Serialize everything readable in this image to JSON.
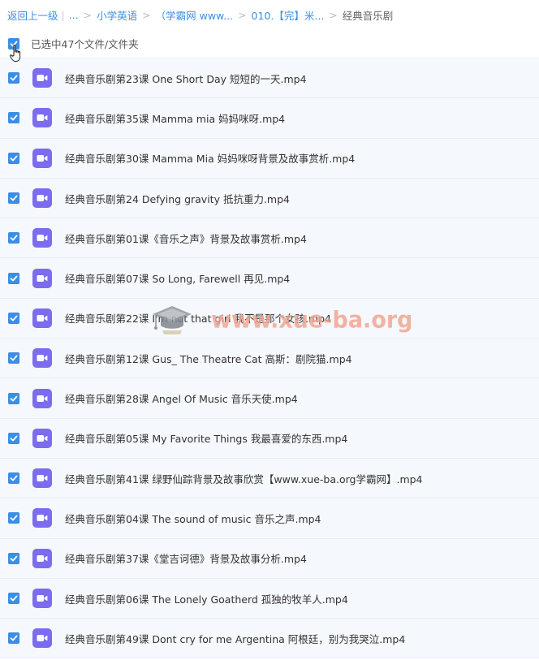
{
  "breadcrumb": {
    "back_label": "返回上一级",
    "ellipsis": "...",
    "items": [
      "小学英语",
      "（学霸网 www...",
      "010.【完】米..."
    ],
    "current": "经典音乐剧"
  },
  "selection": {
    "label": "已选中47个文件/文件夹",
    "checked": true
  },
  "files": [
    {
      "name": "经典音乐剧第23课 One Short Day 短短的一天.mp4",
      "checked": true
    },
    {
      "name": "经典音乐剧第35课 Mamma mia 妈妈咪呀.mp4",
      "checked": true
    },
    {
      "name": "经典音乐剧第30课 Mamma Mia 妈妈咪呀背景及故事赏析.mp4",
      "checked": true
    },
    {
      "name": "经典音乐剧第24 Defying  gravity 抵抗重力.mp4",
      "checked": true
    },
    {
      "name": "经典音乐剧第01课《音乐之声》背景及故事赏析.mp4",
      "checked": true
    },
    {
      "name": "经典音乐剧第07课 So Long, Farewell 再见.mp4",
      "checked": true
    },
    {
      "name": "经典音乐剧第22课 I'm not that girl 我不是那个女孩.mp4",
      "checked": true
    },
    {
      "name": "经典音乐剧第12课 Gus_ The Theatre Cat 高斯：剧院猫.mp4",
      "checked": true
    },
    {
      "name": "经典音乐剧第28课 Angel Of Music 音乐天使.mp4",
      "checked": true
    },
    {
      "name": "经典音乐剧第05课 My Favorite Things 我最喜爱的东西.mp4",
      "checked": true
    },
    {
      "name": "经典音乐剧第41课 绿野仙踪背景及故事欣赏【www.xue-ba.org学霸网】.mp4",
      "checked": true
    },
    {
      "name": "经典音乐剧第04课 The sound of music 音乐之声.mp4",
      "checked": true
    },
    {
      "name": "经典音乐剧第37课《堂吉诃德》背景及故事分析.mp4",
      "checked": true
    },
    {
      "name": "经典音乐剧第06课 The Lonely Goatherd 孤独的牧羊人.mp4",
      "checked": true
    },
    {
      "name": "经典音乐剧第49课 Dont cry for me Argentina 阿根廷，别为我哭泣.mp4",
      "checked": true
    }
  ],
  "icons": {
    "file_type": "video-file-icon",
    "check": "checkmark-icon",
    "cursor": "hand-pointer-icon",
    "watermark_logo": "graduation-cap-icon"
  },
  "colors": {
    "accent": "#3a8ee6",
    "video_icon": "#7b6cf0",
    "row_background": "#f5f8fd",
    "watermark": "#f2a38f"
  },
  "watermark": {
    "text": "www.xue-ba.org"
  }
}
